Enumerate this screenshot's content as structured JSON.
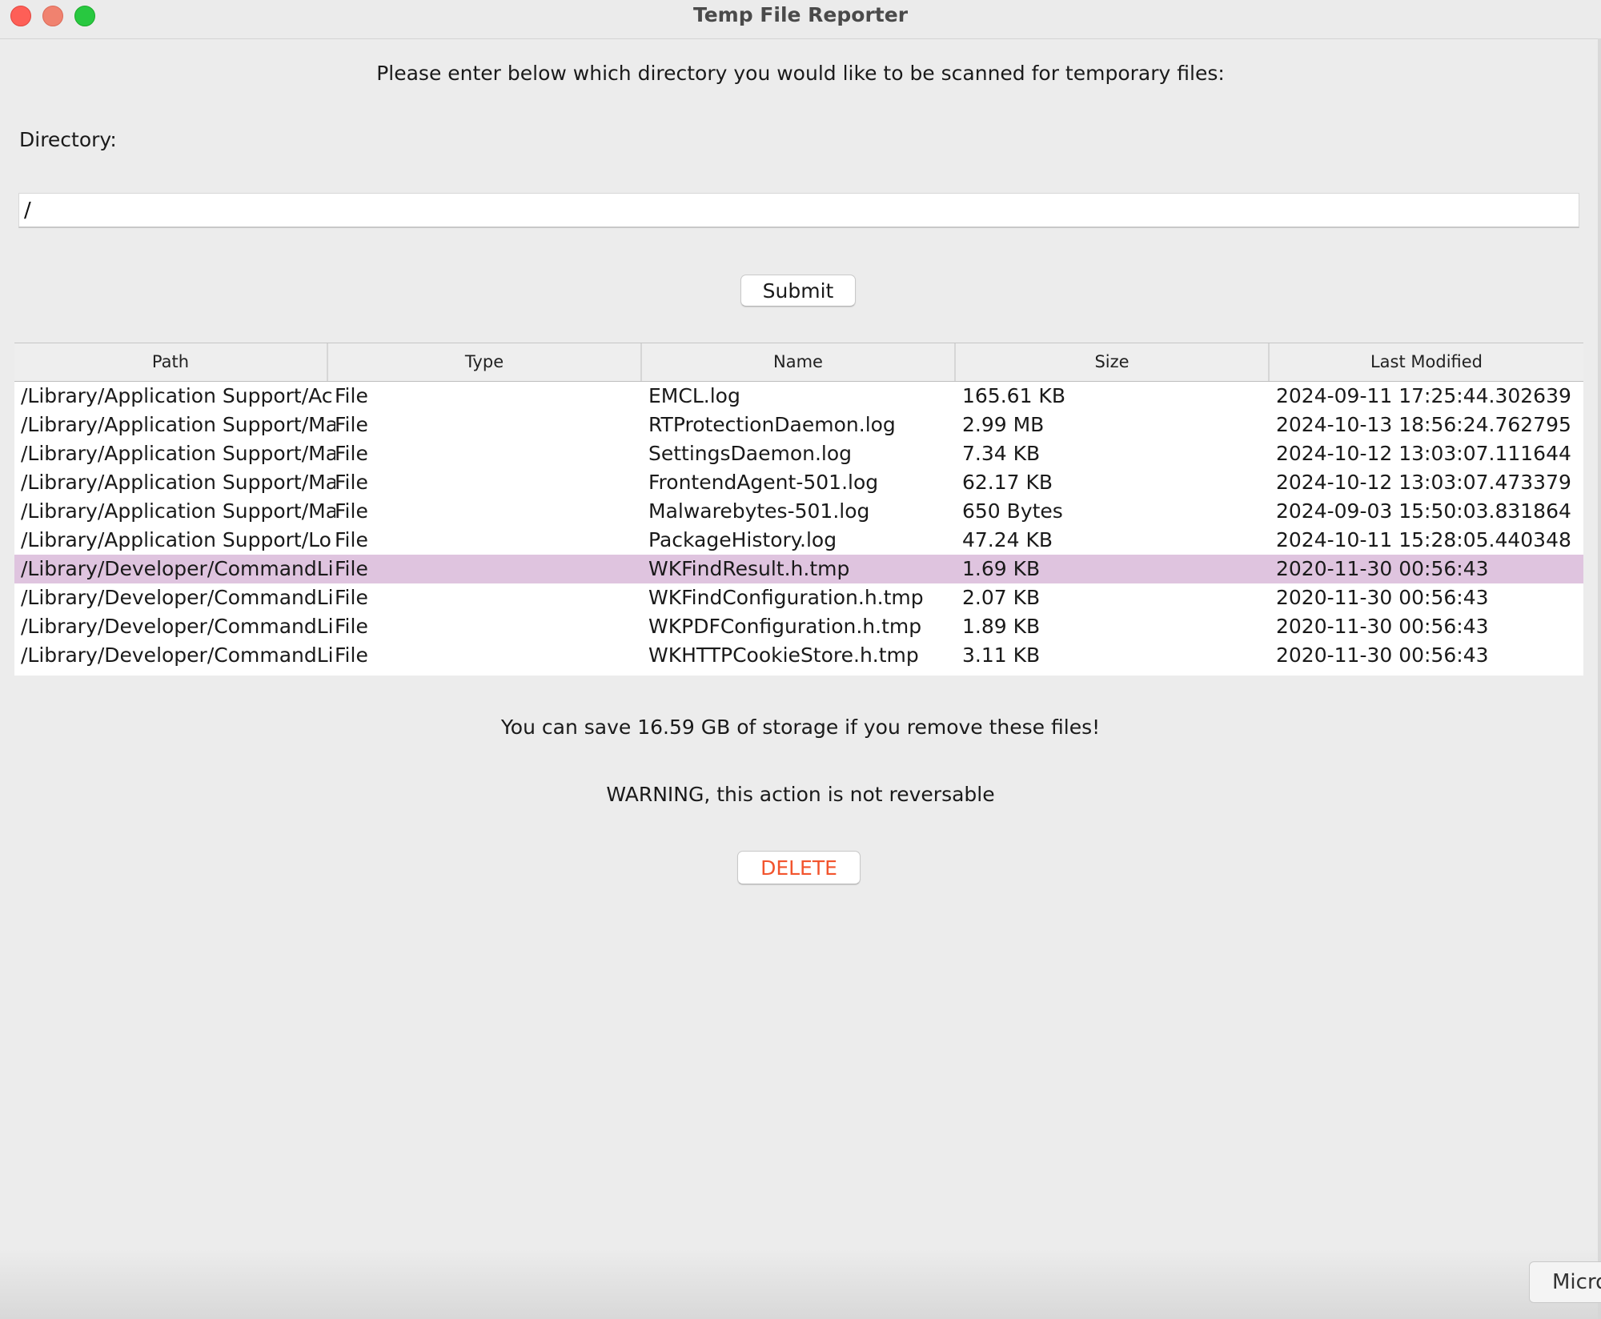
{
  "window": {
    "title": "Temp File Reporter"
  },
  "prompt": "Please enter below which directory you would like to be scanned for temporary files:",
  "directory": {
    "label": "Directory:",
    "value": "/"
  },
  "submit_label": "Submit",
  "table": {
    "columns": [
      "Path",
      "Type",
      "Name",
      "Size",
      "Last Modified"
    ],
    "selected_row": 6,
    "rows": [
      {
        "path": "/Library/Application Support/Ac",
        "type": "File",
        "name": "EMCL.log",
        "size": "165.61 KB",
        "modified": "2024-09-11 17:25:44.302639"
      },
      {
        "path": "/Library/Application Support/Ma",
        "type": "File",
        "name": "RTProtectionDaemon.log",
        "size": "2.99 MB",
        "modified": "2024-10-13 18:56:24.762795"
      },
      {
        "path": "/Library/Application Support/Ma",
        "type": "File",
        "name": "SettingsDaemon.log",
        "size": "7.34 KB",
        "modified": "2024-10-12 13:03:07.111644"
      },
      {
        "path": "/Library/Application Support/Ma",
        "type": "File",
        "name": "FrontendAgent-501.log",
        "size": "62.17 KB",
        "modified": "2024-10-12 13:03:07.473379"
      },
      {
        "path": "/Library/Application Support/Ma",
        "type": "File",
        "name": "Malwarebytes-501.log",
        "size": "650 Bytes",
        "modified": "2024-09-03 15:50:03.831864"
      },
      {
        "path": "/Library/Application Support/Lo",
        "type": "File",
        "name": "PackageHistory.log",
        "size": "47.24 KB",
        "modified": "2024-10-11 15:28:05.440348"
      },
      {
        "path": "/Library/Developer/CommandLi",
        "type": "File",
        "name": "WKFindResult.h.tmp",
        "size": "1.69 KB",
        "modified": "2020-11-30 00:56:43"
      },
      {
        "path": "/Library/Developer/CommandLi",
        "type": "File",
        "name": "WKFindConfiguration.h.tmp",
        "size": "2.07 KB",
        "modified": "2020-11-30 00:56:43"
      },
      {
        "path": "/Library/Developer/CommandLi",
        "type": "File",
        "name": "WKPDFConfiguration.h.tmp",
        "size": "1.89 KB",
        "modified": "2020-11-30 00:56:43"
      },
      {
        "path": "/Library/Developer/CommandLi",
        "type": "File",
        "name": "WKHTTPCookieStore.h.tmp",
        "size": "3.11 KB",
        "modified": "2020-11-30 00:56:43"
      }
    ]
  },
  "save_message": "You can save 16.59 GB of storage if you remove these files!",
  "warning_message": "WARNING, this action is not reversable",
  "delete_label": "DELETE",
  "background_window_button": "Micro",
  "colors": {
    "delete_text": "#f2542d",
    "selected_row": "#dfc4df",
    "close": "#fe5f57",
    "minimize": "#f0826f",
    "zoom": "#28c840"
  }
}
